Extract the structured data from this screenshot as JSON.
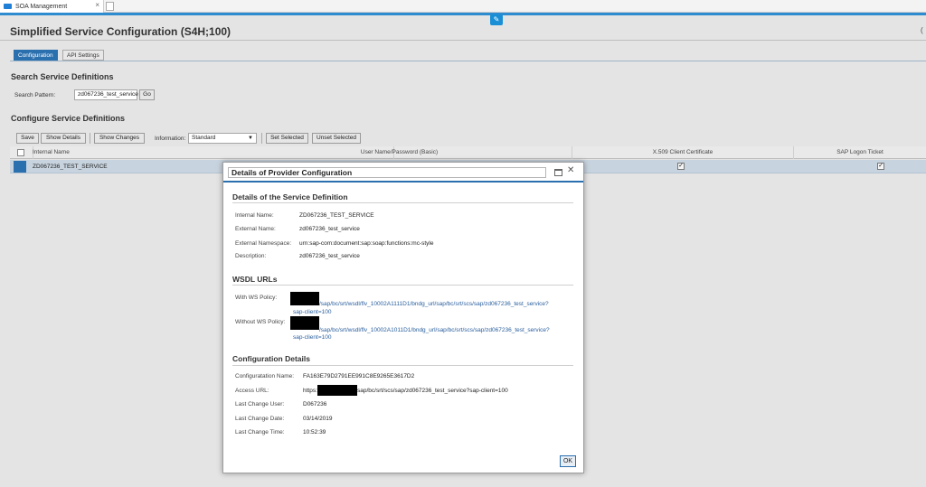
{
  "browser": {
    "tab_title": "SOA Management",
    "tab_close": "×"
  },
  "page": {
    "title": "Simplified Service Configuration (S4H;100)",
    "tabs": [
      {
        "label": "Configuration",
        "active": true
      },
      {
        "label": "API Settings",
        "active": false
      }
    ],
    "search": {
      "section_title": "Search Service Definitions",
      "pattern_label": "Search Pattern:",
      "pattern_value": "zd067236_test_service",
      "go_label": "Go"
    },
    "configure": {
      "section_title": "Configure Service Definitions",
      "toolbar": {
        "save": "Save",
        "show_details": "Show Details",
        "show_changes": "Show Changes",
        "information_label": "Information:",
        "information_value": "Standard",
        "set_selected": "Set Selected",
        "unset_selected": "Unset Selected"
      },
      "table": {
        "columns": [
          "Internal Name",
          "User Name/Password (Basic)",
          "X.509 Client Certificate",
          "SAP Logon Ticket"
        ],
        "rows": [
          {
            "internal_name": "ZD067236_TEST_SERVICE",
            "x509": true,
            "sap_logon_ticket": true
          }
        ]
      }
    }
  },
  "dialog": {
    "title": "Details of Provider Configuration",
    "service_definition": {
      "section_title": "Details of the Service Definition",
      "internal_name_label": "Internal Name:",
      "internal_name": "ZD067236_TEST_SERVICE",
      "external_name_label": "External Name:",
      "external_name": "zd067236_test_service",
      "external_namespace_label": "External Namespace:",
      "external_namespace": "urn:sap-com:document:sap:soap:functions:mc-style",
      "description_label": "Description:",
      "description": "zd067236_test_service"
    },
    "wsdl": {
      "section_title": "WSDL URLs",
      "with_policy_label": "With WS Policy:",
      "with_policy_url_line1": "/sap/bc/srt/wsdl/flv_10002A1111D1/bndg_url/sap/bc/srt/scs/sap/zd067236_test_service?",
      "with_policy_url_line2": "sap-client=100",
      "without_policy_label": "Without WS Policy:",
      "without_policy_url_line1": "/sap/bc/srt/wsdl/flv_10002A1011D1/bndg_url/sap/bc/srt/scs/sap/zd067236_test_service?",
      "without_policy_url_line2": "sap-client=100"
    },
    "configuration": {
      "section_title": "Configuration Details",
      "config_name_label": "Configuratation Name:",
      "config_name": "FA163E79D2791EE991C8E9265E3617D2",
      "access_url_label": "Access URL:",
      "access_url_prefix": "https:",
      "access_url_suffix": "sap/bc/srt/scs/sap/zd067236_test_service?sap-client=100",
      "last_change_user_label": "Last Change User:",
      "last_change_user": "D067236",
      "last_change_date_label": "Last Change Date:",
      "last_change_date": "03/14/2019",
      "last_change_time_label": "Last Change Time:",
      "last_change_time": "10:52:39"
    },
    "ok_label": "OK"
  },
  "colors": {
    "accent": "#2a6fae",
    "link": "#2a5f9e",
    "selected_row": "#c7d3de"
  }
}
